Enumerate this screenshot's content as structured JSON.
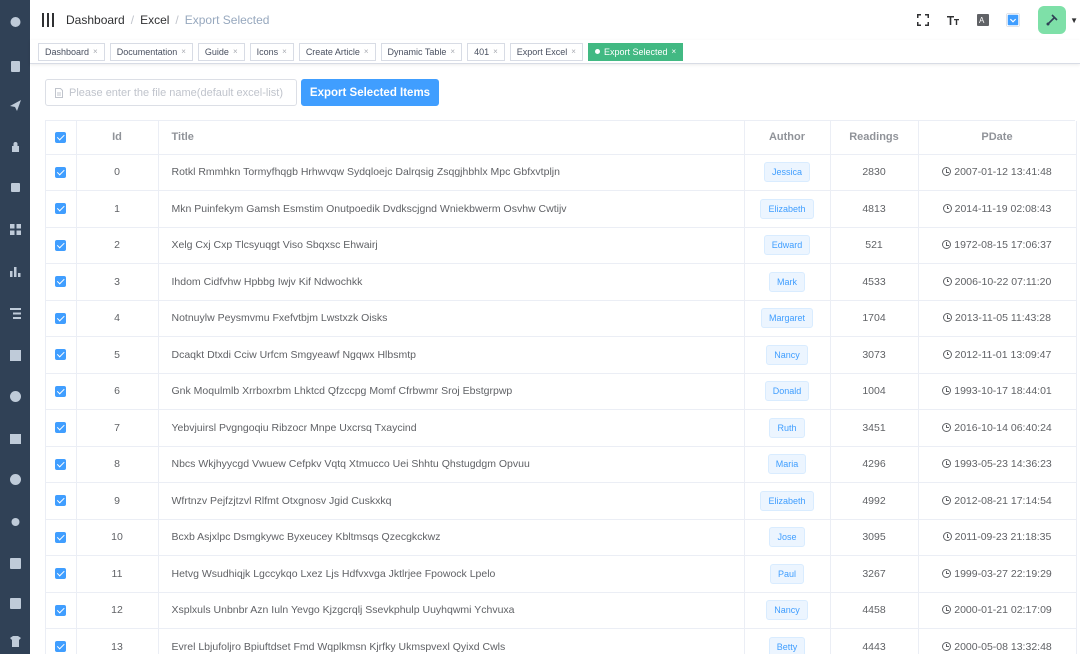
{
  "navbar": {
    "breadcrumb": [
      "Dashboard",
      "Excel",
      "Export Selected"
    ],
    "right_icons": [
      "fullscreen-icon",
      "font-size-icon",
      "translate-icon",
      "theme-color-icon"
    ],
    "theme_color": "#409eff"
  },
  "sidebar": {
    "icons": [
      "dashboard-icon",
      "documentation-icon",
      "guide-icon",
      "permission-icon",
      "icons-icon",
      "components-icon",
      "charts-icon",
      "nested-icon",
      "table-icon",
      "example-icon",
      "tab-icon",
      "error-icon",
      "bug-icon",
      "excel-icon",
      "zip-icon",
      "theme-icon"
    ]
  },
  "tags": [
    {
      "label": "Dashboard",
      "active": false
    },
    {
      "label": "Documentation",
      "active": false
    },
    {
      "label": "Guide",
      "active": false
    },
    {
      "label": "Icons",
      "active": false
    },
    {
      "label": "Create Article",
      "active": false
    },
    {
      "label": "Dynamic Table",
      "active": false
    },
    {
      "label": "401",
      "active": false
    },
    {
      "label": "Export Excel",
      "active": false
    },
    {
      "label": "Export Selected",
      "active": true
    }
  ],
  "toolbar": {
    "filename_placeholder": "Please enter the file name(default excel-list)",
    "filename_value": "",
    "export_label": "Export Selected Items"
  },
  "table": {
    "headers": {
      "id": "Id",
      "title": "Title",
      "author": "Author",
      "readings": "Readings",
      "pdate": "PDate"
    },
    "rows": [
      {
        "id": "0",
        "title": "Rotkl Rmmhkn Tormyfhqgb Hrhwvqw Sydqloejc Dalrqsig Zsqgjhbhlx Mpc Gbfxvtpljn",
        "author": "Jessica",
        "readings": "2830",
        "pdate": "2007-01-12 13:41:48",
        "checked": true
      },
      {
        "id": "1",
        "title": "Mkn Puinfekym Gamsh Esmstim Onutpoedik Dvdkscjgnd Wniekbwerm Osvhw Cwtijv",
        "author": "Elizabeth",
        "readings": "4813",
        "pdate": "2014-11-19 02:08:43",
        "checked": true
      },
      {
        "id": "2",
        "title": "Xelg Cxj Cxp Tlcsyuqgt Viso Sbqxsc Ehwairj",
        "author": "Edward",
        "readings": "521",
        "pdate": "1972-08-15 17:06:37",
        "checked": true
      },
      {
        "id": "3",
        "title": "Ihdom Cidfvhw Hpbbg Iwjv Kif Ndwochkk",
        "author": "Mark",
        "readings": "4533",
        "pdate": "2006-10-22 07:11:20",
        "checked": true
      },
      {
        "id": "4",
        "title": "Notnuylw Peysmvmu Fxefvtbjm Lwstxzk Oisks",
        "author": "Margaret",
        "readings": "1704",
        "pdate": "2013-11-05 11:43:28",
        "checked": true
      },
      {
        "id": "5",
        "title": "Dcaqkt Dtxdi Cciw Urfcm Smgyeawf Ngqwx Hlbsmtp",
        "author": "Nancy",
        "readings": "3073",
        "pdate": "2012-11-01 13:09:47",
        "checked": true
      },
      {
        "id": "6",
        "title": "Gnk Moqulmlb Xrrboxrbm Lhktcd Qfzccpg Momf Cfrbwmr Sroj Ebstgrpwp",
        "author": "Donald",
        "readings": "1004",
        "pdate": "1993-10-17 18:44:01",
        "checked": true
      },
      {
        "id": "7",
        "title": "Yebvjuirsl Pvgngoqiu Ribzocr Mnpe Uxcrsq Txaycind",
        "author": "Ruth",
        "readings": "3451",
        "pdate": "2016-10-14 06:40:24",
        "checked": true
      },
      {
        "id": "8",
        "title": "Nbcs Wkjhyycgd Vwuew Cefpkv Vqtq Xtmucco Uei Shhtu Qhstugdgm Opvuu",
        "author": "Maria",
        "readings": "4296",
        "pdate": "1993-05-23 14:36:23",
        "checked": true
      },
      {
        "id": "9",
        "title": "Wfrtnzv Pejfzjtzvl Rlfmt Otxgnosv Jgid Cuskxkq",
        "author": "Elizabeth",
        "readings": "4992",
        "pdate": "2012-08-21 17:14:54",
        "checked": true
      },
      {
        "id": "10",
        "title": "Bcxb Asjxlpc Dsmgkywc Byxeucey Kbltmsqs Qzecgkckwz",
        "author": "Jose",
        "readings": "3095",
        "pdate": "2011-09-23 21:18:35",
        "checked": true
      },
      {
        "id": "11",
        "title": "Hetvg Wsudhiqjk Lgccykqo Lxez Ljs Hdfvxvga Jktlrjee Fpowock Lpelo",
        "author": "Paul",
        "readings": "3267",
        "pdate": "1999-03-27 22:19:29",
        "checked": true
      },
      {
        "id": "12",
        "title": "Xsplxuls Unbnbr Azn Iuln Yevgo Kjzgcrqlj Ssevkphulp Uuyhqwmi Ychvuxa",
        "author": "Nancy",
        "readings": "4458",
        "pdate": "2000-01-21 02:17:09",
        "checked": true
      },
      {
        "id": "13",
        "title": "Evrel Lbjufoljro Bpiuftdset Fmd Wqplkmsn Kjrfky Ukmspvexl Qyixd Cwls",
        "author": "Betty",
        "readings": "4443",
        "pdate": "2000-05-08 13:32:48",
        "checked": true
      }
    ]
  }
}
